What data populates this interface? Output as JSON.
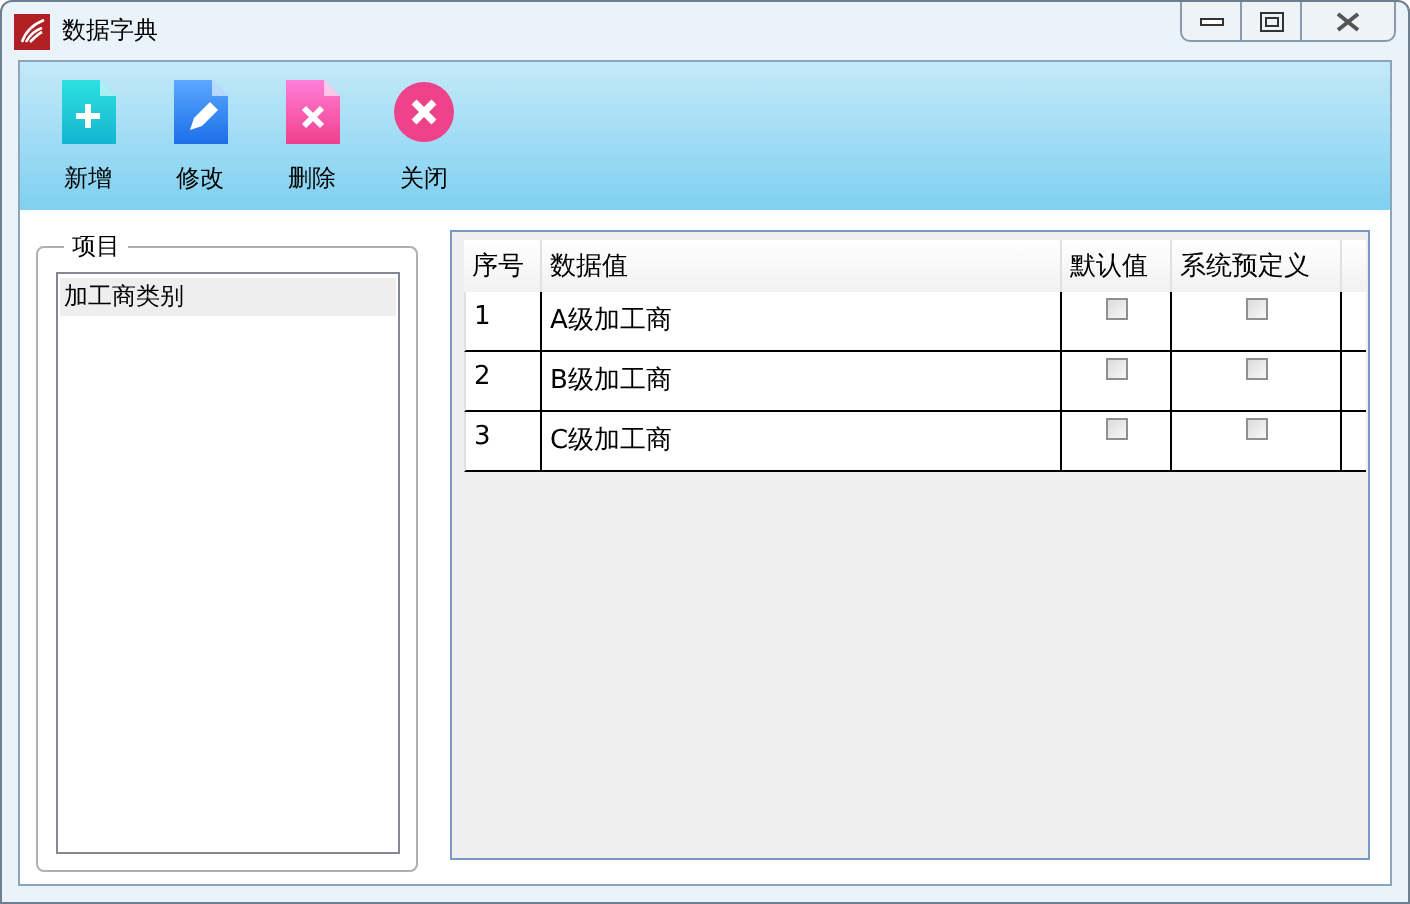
{
  "window": {
    "title": "数据字典"
  },
  "toolbar": [
    {
      "kind": "add",
      "label": "新增"
    },
    {
      "kind": "edit",
      "label": "修改"
    },
    {
      "kind": "delete",
      "label": "删除"
    },
    {
      "kind": "close",
      "label": "关闭"
    }
  ],
  "items_group": {
    "title": "项目",
    "items": [
      {
        "label": "加工商类别",
        "selected": true
      }
    ]
  },
  "table": {
    "columns": [
      "序号",
      "数据值",
      "默认值",
      "系统预定义"
    ],
    "rows": [
      {
        "index": "1",
        "value": "A级加工商",
        "default": false,
        "predefined": false
      },
      {
        "index": "2",
        "value": "B级加工商",
        "default": false,
        "predefined": false
      },
      {
        "index": "3",
        "value": "C级加工商",
        "default": false,
        "predefined": false
      }
    ]
  }
}
